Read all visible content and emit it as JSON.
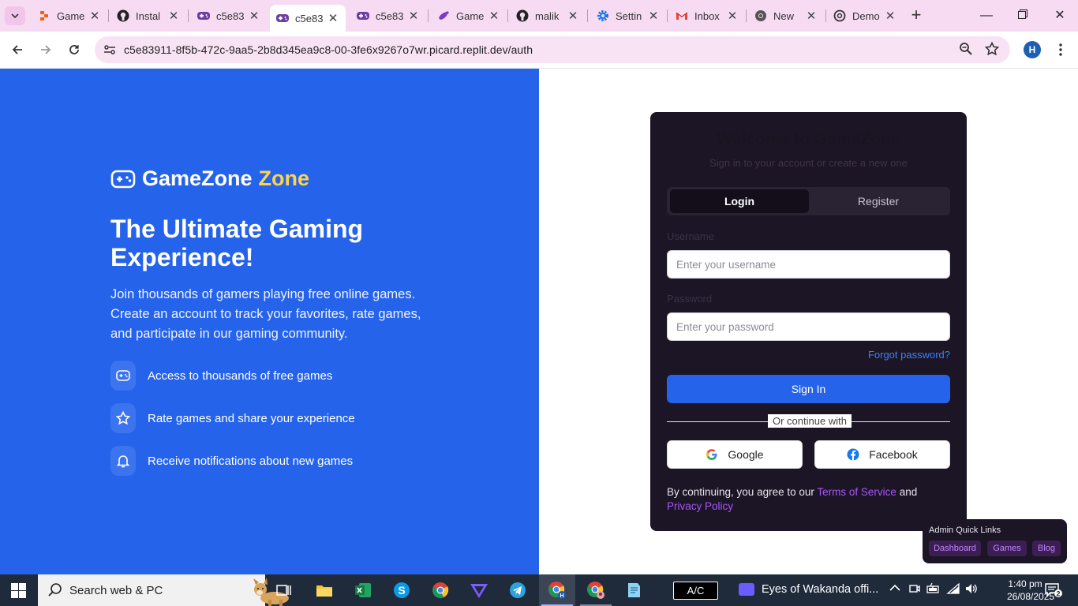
{
  "browser": {
    "tabs": [
      {
        "label": "Game",
        "favicon": "replit-flame-icon"
      },
      {
        "label": "Instal",
        "favicon": "github-icon"
      },
      {
        "label": "c5e83",
        "favicon": "gamepad-icon"
      },
      {
        "label": "c5e83",
        "favicon": "gamepad-icon",
        "active": true
      },
      {
        "label": "c5e83",
        "favicon": "gamepad-icon"
      },
      {
        "label": "Game",
        "favicon": "game-icon"
      },
      {
        "label": "malik",
        "favicon": "github-icon"
      },
      {
        "label": "Settin",
        "favicon": "gear-icon"
      },
      {
        "label": "Inbox",
        "favicon": "gmail-icon"
      },
      {
        "label": "New",
        "favicon": "chrome-icon"
      },
      {
        "label": "Demo",
        "favicon": "openai-icon"
      }
    ],
    "url": "c5e83911-8f5b-472c-9aa5-2b8d345ea9c8-00-3fe6x9267o7wr.picard.replit.dev/auth",
    "profile_initial": "H"
  },
  "hero": {
    "brand_part1": "GameZone",
    "brand_part2": "Zone",
    "headline": "The Ultimate Gaming Experience!",
    "lead": "Join thousands of gamers playing free online games. Create an account to track your favorites, rate games, and participate in our gaming community.",
    "features": [
      {
        "icon": "gamepad-icon",
        "text": "Access to thousands of free games"
      },
      {
        "icon": "star-icon",
        "text": "Rate games and share your experience"
      },
      {
        "icon": "bell-icon",
        "text": "Receive notifications about new games"
      }
    ],
    "colors": {
      "background": "#2563eb",
      "brand_accent": "#fcd34d"
    }
  },
  "auth": {
    "title": "Welcome to GameZone",
    "subtitle": "Sign in to your account or create a new one",
    "tab_login": "Login",
    "tab_register": "Register",
    "username_label": "Username",
    "username_placeholder": "Enter your username",
    "password_label": "Password",
    "password_placeholder": "Enter your password",
    "forgot": "Forgot password?",
    "signin": "Sign In",
    "divider": "Or continue with",
    "google": "Google",
    "facebook": "Facebook",
    "terms_prefix": "By continuing, you agree to our",
    "terms_link": "Terms of Service",
    "terms_and": "and",
    "privacy_link": "Privacy Policy",
    "colors": {
      "card": "#1c1526",
      "primary": "#2563eb",
      "link": "#a855f7"
    }
  },
  "admin_quick_links": {
    "title": "Admin Quick Links",
    "links": [
      "Dashboard",
      "Games",
      "Blog"
    ]
  },
  "taskbar": {
    "search_placeholder": "Search web & PC",
    "ac_label": "A/C",
    "media_title": "Eyes of Wakanda offi...",
    "time": "1:40 pm",
    "date": "26/08/2025",
    "notification_count": "2"
  }
}
